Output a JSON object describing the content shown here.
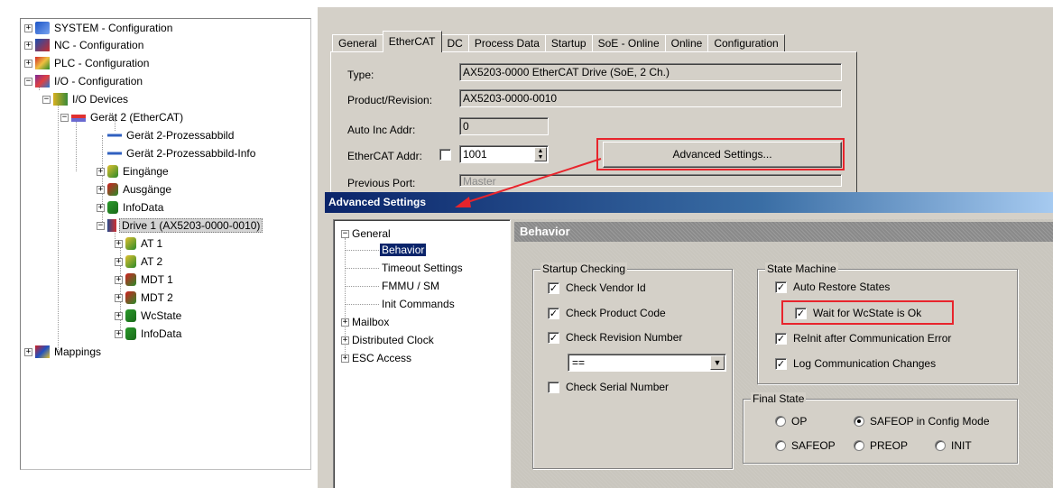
{
  "tree": {
    "items": [
      {
        "label": "SYSTEM - Configuration",
        "exp": "+",
        "icon": "system-config-icon"
      },
      {
        "label": "NC - Configuration",
        "exp": "+",
        "icon": "nc-config-icon"
      },
      {
        "label": "PLC - Configuration",
        "exp": "+",
        "icon": "plc-config-icon"
      },
      {
        "label": "I/O - Configuration",
        "exp": "-",
        "icon": "io-config-icon"
      },
      {
        "label": "I/O Devices",
        "exp": "-",
        "icon": "io-devices-icon"
      },
      {
        "label": "Gerät 2 (EtherCAT)",
        "exp": "-",
        "icon": "ethercat-device-icon"
      },
      {
        "label": "Gerät 2-Prozessabbild",
        "exp": "",
        "icon": "process-image-icon"
      },
      {
        "label": "Gerät 2-Prozessabbild-Info",
        "exp": "",
        "icon": "process-image-info-icon"
      },
      {
        "label": "Eingänge",
        "exp": "+",
        "icon": "inputs-icon"
      },
      {
        "label": "Ausgänge",
        "exp": "+",
        "icon": "outputs-icon"
      },
      {
        "label": "InfoData",
        "exp": "+",
        "icon": "infodata-icon"
      },
      {
        "label": "Drive 1 (AX5203-0000-0010)",
        "exp": "-",
        "icon": "drive-icon"
      },
      {
        "label": "AT 1",
        "exp": "+",
        "icon": "at-icon"
      },
      {
        "label": "AT 2",
        "exp": "+",
        "icon": "at-icon"
      },
      {
        "label": "MDT 1",
        "exp": "+",
        "icon": "mdt-icon"
      },
      {
        "label": "MDT 2",
        "exp": "+",
        "icon": "mdt-icon"
      },
      {
        "label": "WcState",
        "exp": "+",
        "icon": "wcstate-icon"
      },
      {
        "label": "InfoData",
        "exp": "+",
        "icon": "infodata-icon"
      },
      {
        "label": "Mappings",
        "exp": "+",
        "icon": "mappings-icon"
      }
    ]
  },
  "tabs": [
    "General",
    "EtherCAT",
    "DC",
    "Process Data",
    "Startup",
    "SoE - Online",
    "Online",
    "Configuration"
  ],
  "active_tab": "EtherCAT",
  "ethercat": {
    "type_label": "Type:",
    "type_value": "AX5203-0000 EtherCAT Drive (SoE, 2 Ch.)",
    "product_label": "Product/Revision:",
    "product_value": "AX5203-0000-0010",
    "autoinc_label": "Auto Inc Addr:",
    "autoinc_value": "0",
    "addr_label": "EtherCAT Addr:",
    "addr_value": "1001",
    "advanced_button": "Advanced Settings...",
    "prevport_label": "Previous Port:",
    "prevport_value": "Master"
  },
  "advanced": {
    "title": "Advanced Settings",
    "tree": {
      "general": "General",
      "behavior": "Behavior",
      "timeout": "Timeout Settings",
      "fmmu": "FMMU / SM",
      "init": "Init Commands",
      "mailbox": "Mailbox",
      "dc": "Distributed Clock",
      "esc": "ESC Access"
    },
    "header": "Behavior",
    "startup": {
      "title": "Startup Checking",
      "vendor": "Check Vendor Id",
      "product": "Check Product Code",
      "revision": "Check Revision Number",
      "combo_value": "==",
      "serial": "Check Serial Number"
    },
    "state_machine": {
      "title": "State Machine",
      "auto_restore": "Auto Restore States",
      "wait_wcstate": "Wait for WcState is Ok",
      "reinit": "ReInit after Communication Error",
      "log": "Log Communication Changes"
    },
    "final_state": {
      "title": "Final State",
      "op": "OP",
      "safeop_config": "SAFEOP in Config Mode",
      "safeop": "SAFEOP",
      "preop": "PREOP",
      "init": "INIT"
    }
  },
  "colors": {
    "highlight_red": "#e8242c",
    "titlebar": "#0a246a"
  }
}
